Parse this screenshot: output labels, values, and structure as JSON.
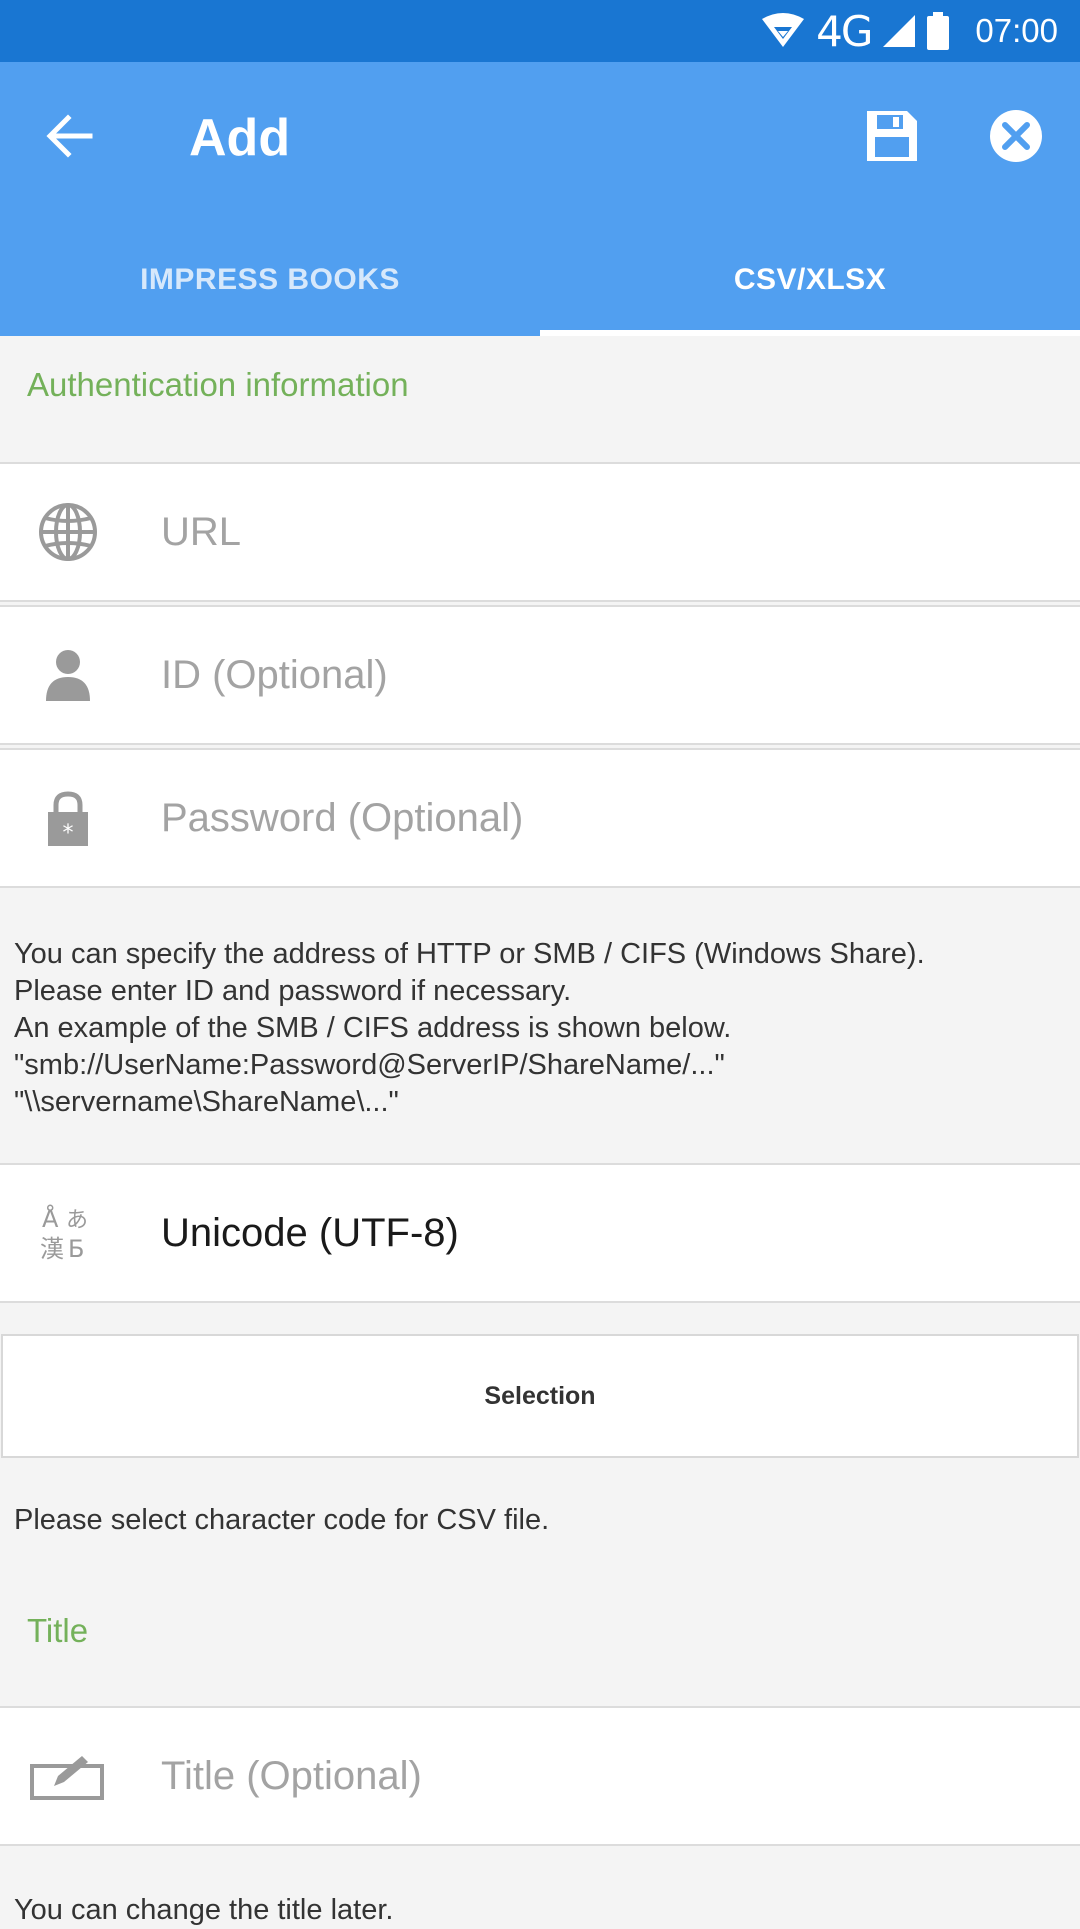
{
  "status_bar": {
    "network": "4G",
    "time": "07:00",
    "icons": [
      "wifi-icon",
      "signal-icon",
      "battery-icon"
    ]
  },
  "app_bar": {
    "title": "Add",
    "back_icon": "arrow-back-icon",
    "save_icon": "save-icon",
    "close_icon": "close-circle-icon"
  },
  "tabs": [
    {
      "label": "IMPRESS BOOKS",
      "active": false
    },
    {
      "label": "CSV/XLSX",
      "active": true
    }
  ],
  "auth": {
    "section_label": "Authentication information",
    "url_placeholder": "URL",
    "id_placeholder": "ID (Optional)",
    "password_placeholder": "Password (Optional)",
    "help_lines": [
      "You can specify the address of HTTP or SMB / CIFS (Windows Share).",
      "Please enter ID and password if necessary.",
      "An example of the SMB / CIFS address is shown below.",
      "\"smb://UserName:Password@ServerIP/ShareName/...\"",
      "\"\\\\servername\\ShareName\\...\""
    ]
  },
  "encoding": {
    "value": "Unicode (UTF-8)",
    "selection_button": "Selection",
    "help": "Please select character code for CSV file."
  },
  "title_section": {
    "section_label": "Title",
    "title_placeholder": "Title (Optional)",
    "help": "You can change the title later."
  },
  "colors": {
    "status_bar": "#1976d2",
    "app_bar": "#519ff0",
    "section_label": "#74b15a",
    "background": "#f4f4f4"
  }
}
